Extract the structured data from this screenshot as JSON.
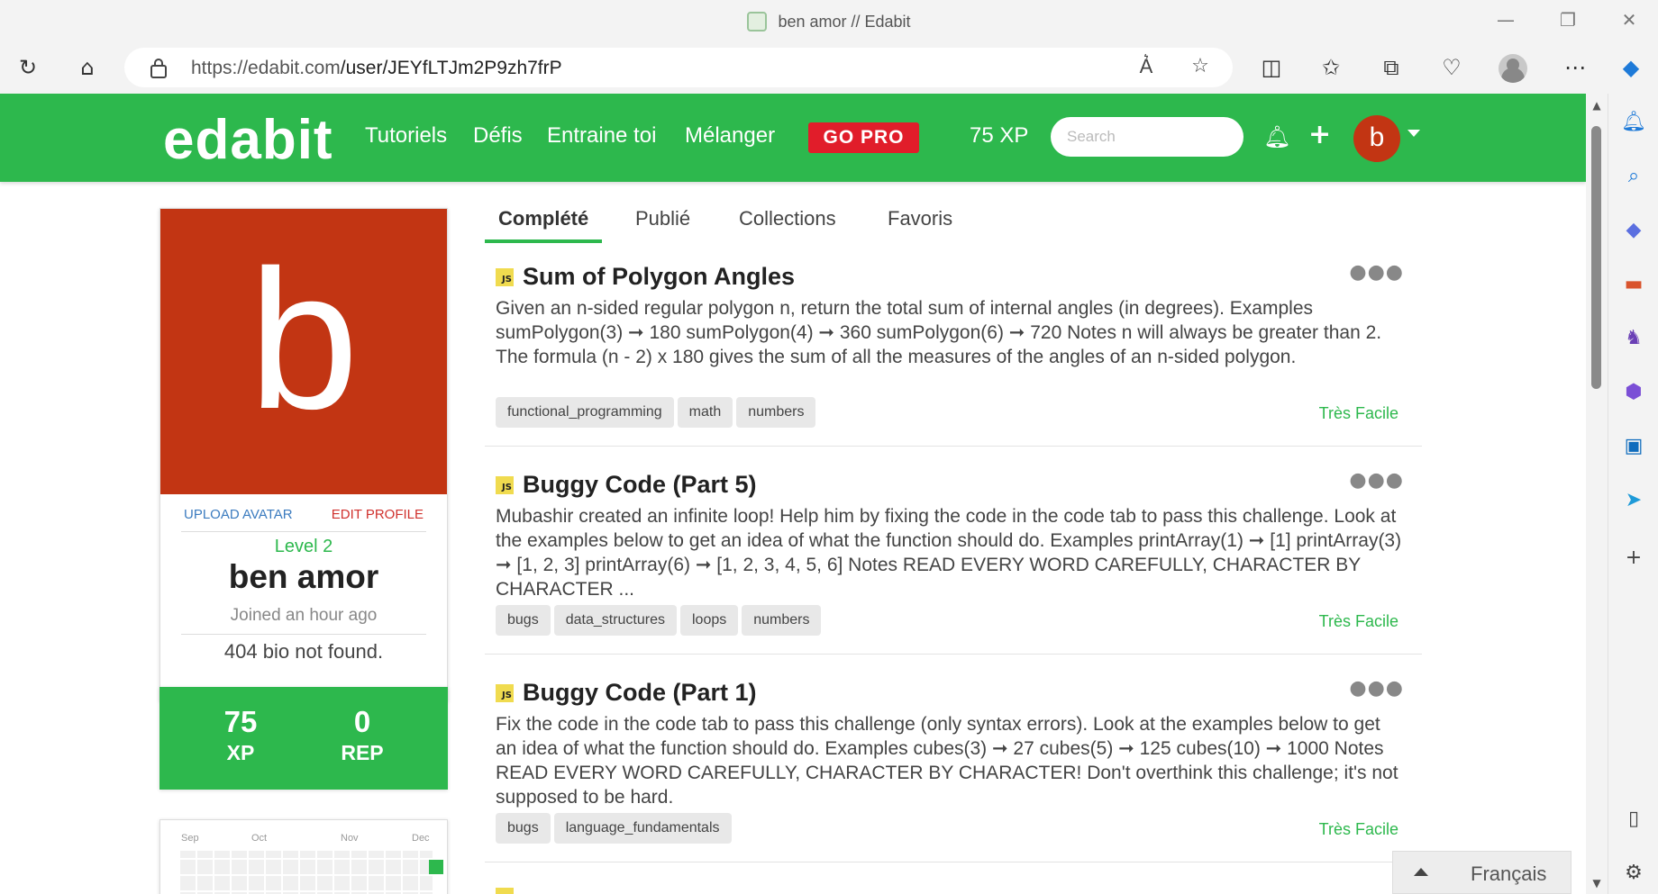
{
  "window": {
    "title": "ben amor // Edabit"
  },
  "browser": {
    "url_host": "https://edabit.com",
    "url_path": "/user/JEYfLTJm2P9zh7frP"
  },
  "header": {
    "logo": "edabit",
    "nav": [
      "Tutoriels",
      "Défis",
      "Entraine toi",
      "Mélanger"
    ],
    "go_pro": "GO PRO",
    "xp": "75 XP",
    "search_placeholder": "Search",
    "user_initial": "b"
  },
  "profile": {
    "initial": "b",
    "upload_avatar": "UPLOAD AVATAR",
    "edit_profile": "EDIT PROFILE",
    "level": "Level 2",
    "name": "ben amor",
    "joined": "Joined an hour ago",
    "bio": "404 bio not found.",
    "stats": [
      {
        "value": "75",
        "label": "XP"
      },
      {
        "value": "0",
        "label": "REP"
      }
    ],
    "calendar_months": [
      "Sep",
      "Oct",
      "Nov",
      "Dec"
    ]
  },
  "tabs": [
    "Complété",
    "Publié",
    "Collections",
    "Favoris"
  ],
  "active_tab": "Complété",
  "challenges": [
    {
      "lang": "JS",
      "title": "Sum of Polygon Angles",
      "description": "Given an n-sided regular polygon n, return the total sum of internal angles (in degrees). Examples sumPolygon(3) ➞ 180 sumPolygon(4) ➞ 360 sumPolygon(6) ➞ 720 Notes n will always be greater than 2. The formula (n - 2) x 180 gives the sum of all the measures of the angles of an n-sided polygon.",
      "tags": [
        "functional_programming",
        "math",
        "numbers"
      ],
      "difficulty": "Très Facile"
    },
    {
      "lang": "JS",
      "title": "Buggy Code (Part 5)",
      "description": "Mubashir created an infinite loop! Help him by fixing the code in the code tab to pass this challenge. Look at the examples below to get an idea of what the function should do. Examples printArray(1) ➞ [1] printArray(3) ➞ [1, 2, 3] printArray(6) ➞ [1, 2, 3, 4, 5, 6] Notes READ EVERY WORD CAREFULLY, CHARACTER BY CHARACTER ...",
      "tags": [
        "bugs",
        "data_structures",
        "loops",
        "numbers"
      ],
      "difficulty": "Très Facile"
    },
    {
      "lang": "JS",
      "title": "Buggy Code (Part 1)",
      "description": "Fix the code in the code tab to pass this challenge (only syntax errors). Look at the examples below to get an idea of what the function should do. Examples cubes(3) ➞ 27 cubes(5) ➞ 125 cubes(10) ➞ 1000 Notes READ EVERY WORD CAREFULLY, CHARACTER BY CHARACTER! Don't overthink this challenge; it's not supposed to be hard.",
      "tags": [
        "bugs",
        "language_fundamentals"
      ],
      "difficulty": "Très Facile"
    }
  ],
  "language": "Français",
  "colors": {
    "brand_green": "#2db84d",
    "go_pro_red": "#e11d2a",
    "avatar_red": "#c23513"
  }
}
